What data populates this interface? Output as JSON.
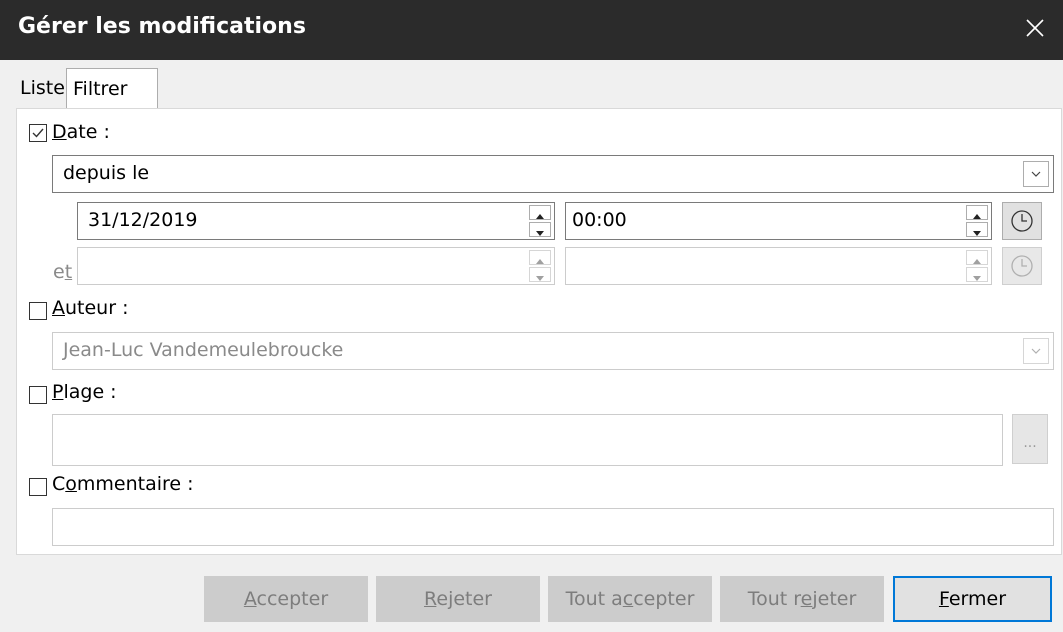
{
  "window": {
    "title": "Gérer les modifications"
  },
  "tabs": [
    {
      "label": "Liste"
    },
    {
      "label": "Filtrer"
    }
  ],
  "filter": {
    "date": {
      "label_first": "D",
      "label_rest": "ate :",
      "checked": true,
      "condition": "depuis le",
      "date_value": "31/12/2019",
      "time_value": "00:00",
      "and_label_first": "e",
      "and_label_under": "t"
    },
    "author": {
      "label_first": "A",
      "label_rest": "uteur :",
      "checked": false,
      "value": "Jean-Luc Vandemeulebroucke"
    },
    "range": {
      "label_first": "P",
      "label_rest": "lage :",
      "checked": false,
      "value": "",
      "browse_label": "..."
    },
    "comment": {
      "label_pre": "C",
      "label_u": "o",
      "label_rest": "mmentaire :",
      "checked": false,
      "value": ""
    }
  },
  "buttons": {
    "accept": {
      "u": "A",
      "rest": "ccepter"
    },
    "reject": {
      "u": "R",
      "rest": "ejeter"
    },
    "accept_all": {
      "pre": "Tout a",
      "u": "c",
      "rest": "cepter"
    },
    "reject_all": {
      "pre": "Tout r",
      "u": "e",
      "rest": "jeter"
    },
    "close": {
      "u": "F",
      "rest": "ermer"
    }
  }
}
